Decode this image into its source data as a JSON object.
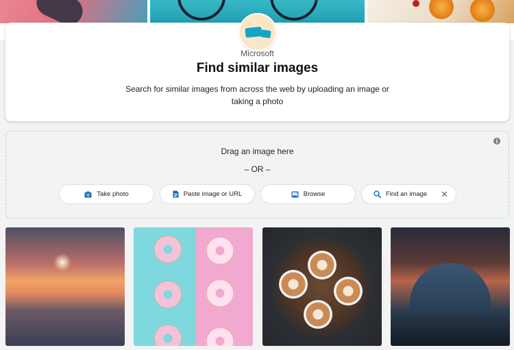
{
  "card": {
    "brand": "Microsoft",
    "title": "Find similar images",
    "subtitle": "Search for similar images from across the web by uploading an image or taking a photo"
  },
  "dropzone": {
    "drag_text": "Drag an image here",
    "or_text": "– OR –",
    "info_icon": "info-icon",
    "buttons": {
      "take_photo": {
        "label": "Take photo",
        "icon": "camera-icon"
      },
      "paste": {
        "label": "Paste image or URL",
        "icon": "document-icon"
      },
      "browse": {
        "label": "Browse",
        "icon": "image-icon"
      },
      "find": {
        "placeholder": "Find an image",
        "icon": "search-icon",
        "clear_icon": "close-icon"
      }
    }
  },
  "colors": {
    "accent": "#0f6cbd",
    "dropzone_border": "#a9d6da",
    "page_bg": "#f3f3f3"
  },
  "gallery": {
    "tiles": [
      "sunset-sea",
      "donuts",
      "latte-cups",
      "arch-structure"
    ]
  }
}
